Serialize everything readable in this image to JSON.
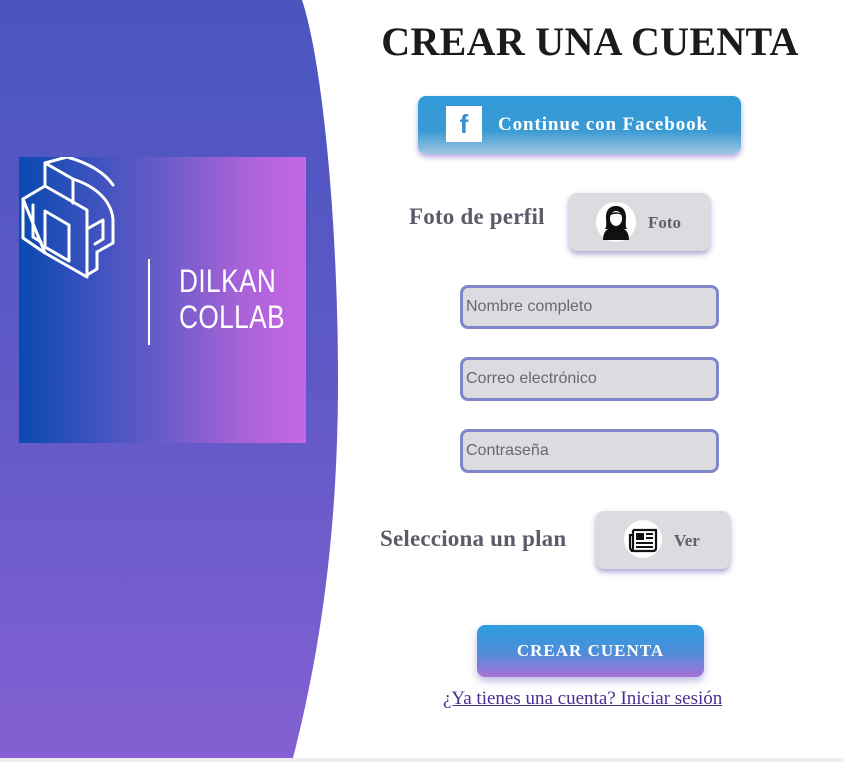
{
  "brand": {
    "line1": "DILKAN",
    "line2": "COLLAB"
  },
  "colors": {
    "panel_top": "#4c58c2",
    "panel_bottom": "#8360d2",
    "accent": "#7f86c9",
    "link": "#4b2f8f"
  },
  "form": {
    "title": "CREAR UNA CUENTA",
    "facebook_button": {
      "icon": "facebook-icon",
      "label": "Continue con Facebook"
    },
    "profile_photo": {
      "label": "Foto de perfil",
      "button_label": "Foto",
      "icon": "user-avatar-icon"
    },
    "fields": {
      "name_placeholder": "Nombre completo",
      "email_placeholder": "Correo electrónico",
      "password_placeholder": "Contraseña"
    },
    "plan": {
      "label": "Selecciona un plan",
      "button_label": "Ver",
      "icon": "newspaper-icon"
    },
    "submit_label": "CREAR CUENTA",
    "login_link": "¿Ya tienes una cuenta? Iniciar sesión"
  }
}
